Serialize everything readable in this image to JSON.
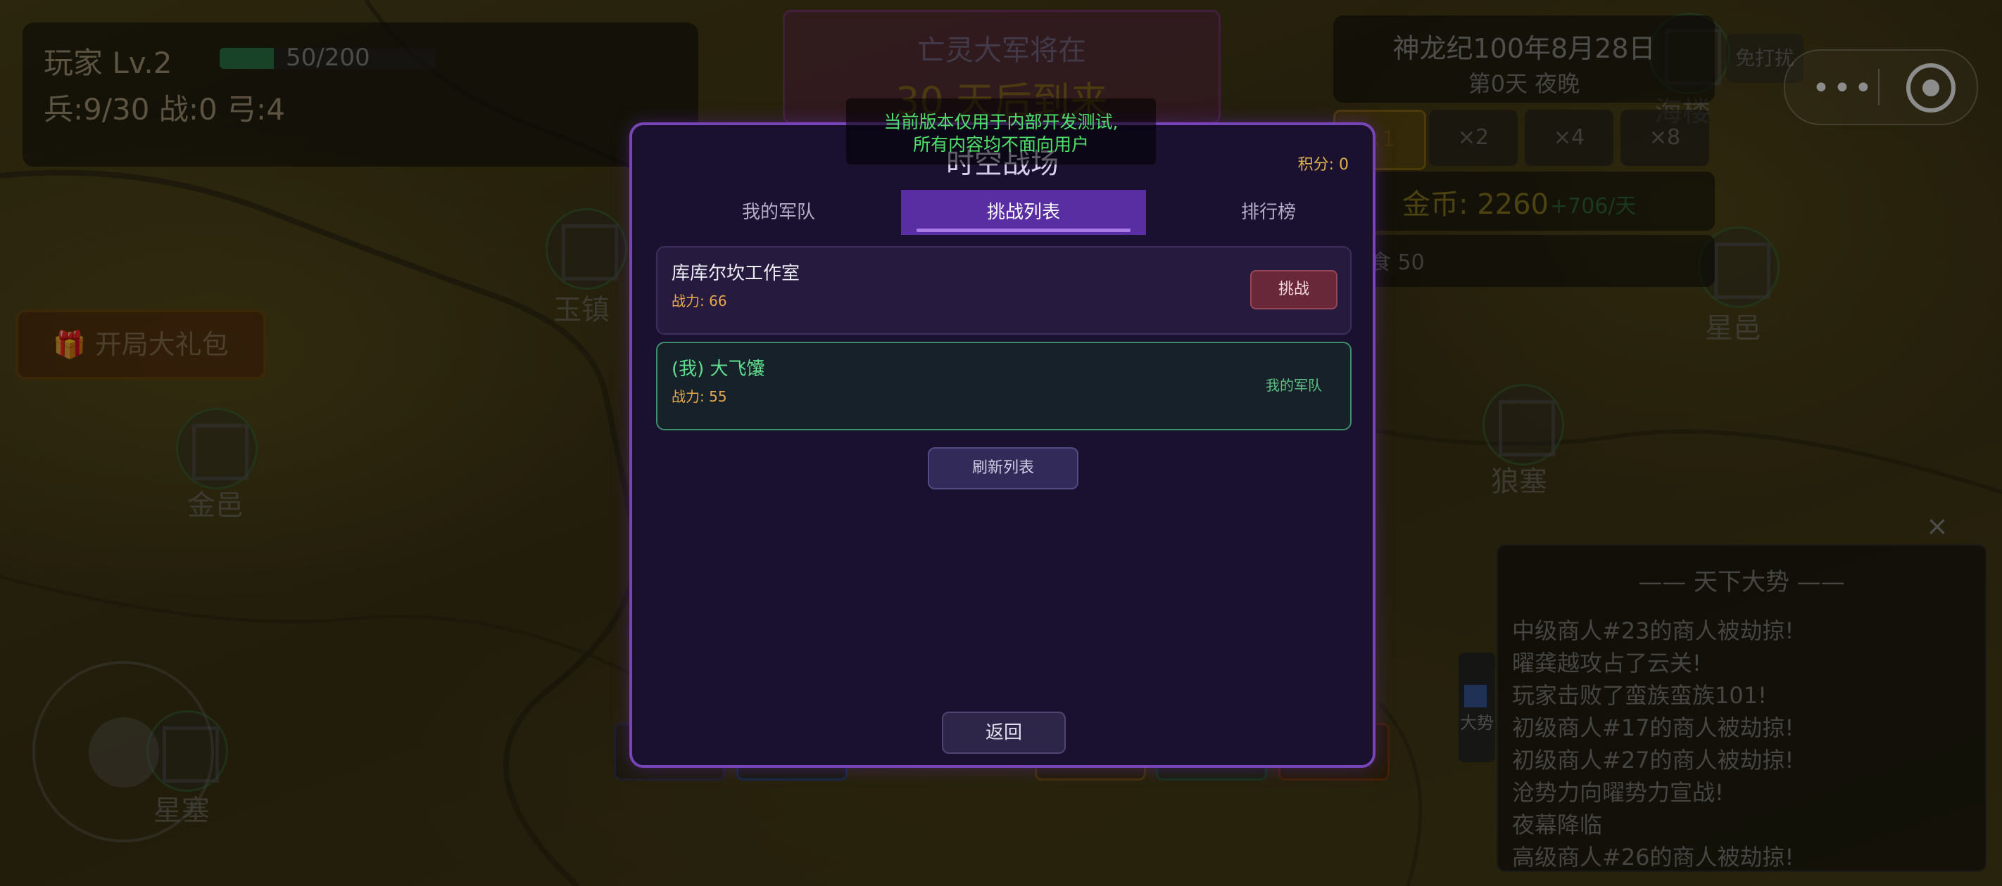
{
  "hud": {
    "player_label": "玩家  Lv.2",
    "hp_text": "50/200",
    "hp_fraction": 0.25,
    "army_stats": "兵:9/30   战:0  弓:4"
  },
  "undead_banner": {
    "line1": "亡灵大军将在",
    "line2": "30 天后到来"
  },
  "date": {
    "line1": "神龙纪100年8月28日",
    "line2": "第0天  夜晚"
  },
  "speed_options": [
    "×1",
    "×2",
    "×4",
    "×8"
  ],
  "gold": {
    "label": "金币: 2260",
    "rate": "+706/天"
  },
  "food_label": "食 50",
  "no_fight_label": "免打扰",
  "gift_button": "🎁 开局大礼包",
  "cities": [
    "玉镇",
    "金邑",
    "星邑",
    "狼塞",
    "星塞",
    "海楼"
  ],
  "news": {
    "title": "—— 天下大势 ——",
    "items": [
      "中级商人#23的商人被劫掠!",
      "曜龚越攻占了云关!",
      "玩家击败了蛮族蛮族101!",
      "初级商人#17的商人被劫掠!",
      "初级商人#27的商人被劫掠!",
      "沧势力向曜势力宣战!",
      "夜幕降临",
      "高级商人#26的商人被劫掠!"
    ],
    "close_icon": "×"
  },
  "trend_tab": {
    "label": "大势"
  },
  "notice": {
    "line1": "当前版本仅用于内部开发测试,",
    "line2": "所有内容均不面向用户"
  },
  "modal": {
    "title": "时空战场",
    "score": "积分: 0",
    "tabs": [
      {
        "label": "我的军队",
        "active": false
      },
      {
        "label": "挑战列表",
        "active": true
      },
      {
        "label": "排行榜",
        "active": false
      }
    ],
    "entries": [
      {
        "name": "库库尔坎工作室",
        "power": "战力: 66",
        "action": "挑战"
      },
      {
        "name": "(我) 大飞馕",
        "power": "战力: 55",
        "tag": "我的军队"
      }
    ],
    "refresh_label": "刷新列表",
    "return_label": "返回"
  },
  "colors": {
    "modal_bg": "#1a1131",
    "modal_border": "#7845b6",
    "active_tab": "#5a2ea3",
    "power_text": "#e4a94a",
    "my_entry_border": "#3d8f6a",
    "notice_text": "#4fe06b"
  }
}
